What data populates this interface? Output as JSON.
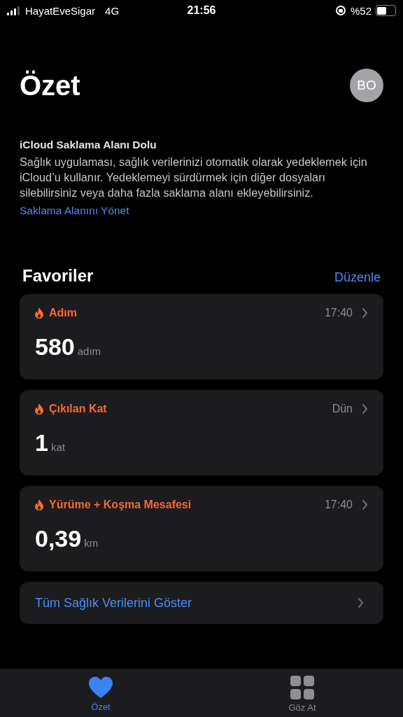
{
  "status_bar": {
    "carrier": "HayatEveSigar",
    "network": "4G",
    "time": "21:56",
    "battery_text": "%52"
  },
  "header": {
    "title": "Özet",
    "avatar": "BO"
  },
  "notice": {
    "title": "iCloud Saklama Alanı Dolu",
    "body": "Sağlık uygulaması, sağlık verilerinizi otomatik olarak yedeklemek için iCloud’u kullanır. Yedeklemeyi sürdürmek için diğer dosyaları silebilirsiniz veya daha fazla saklama alanı ekleyebilirsiniz.",
    "link": "Saklama Alanını Yönet"
  },
  "favorites": {
    "title": "Favoriler",
    "edit": "Düzenle",
    "cards": [
      {
        "label": "Adım",
        "time": "17:40",
        "value": "580",
        "unit": "adım"
      },
      {
        "label": "Çıkılan Kat",
        "time": "Dün",
        "value": "1",
        "unit": "kat"
      },
      {
        "label": "Yürüme + Koşma Mesafesi",
        "time": "17:40",
        "value": "0,39",
        "unit": "km"
      }
    ],
    "show_all": "Tüm Sağlık Verilerini Göster"
  },
  "tab_bar": [
    {
      "label": "Özet",
      "kind": "heart",
      "selected": true
    },
    {
      "label": "Göz At",
      "kind": "grid",
      "selected": false
    }
  ]
}
